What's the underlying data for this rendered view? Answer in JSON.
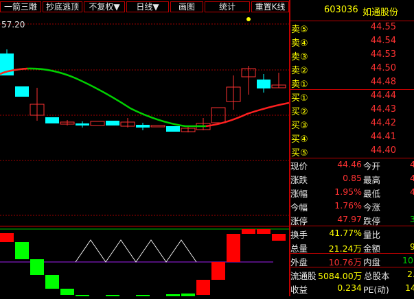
{
  "toolbar": {
    "items": [
      "一箭三雕",
      "抄底逃顶",
      "不复权▼",
      "日线▼",
      "画图",
      "统计",
      "重置K线"
    ]
  },
  "chart": {
    "price_label": "57.20",
    "colors": {
      "up": "#ff3232",
      "down": "#00ffff",
      "ma_up": "#ff2020",
      "ma_down": "#00e000",
      "grid": "#a00000",
      "indicator_line": "#a020f0"
    }
  },
  "quote": {
    "code": "603036",
    "name": "如通股份",
    "asks": [
      {
        "label": "卖⑤",
        "price": "44.55"
      },
      {
        "label": "卖④",
        "price": "44.54"
      },
      {
        "label": "卖③",
        "price": "44.53"
      },
      {
        "label": "卖②",
        "price": "44.50"
      },
      {
        "label": "卖①",
        "price": "44.48"
      }
    ],
    "bids": [
      {
        "label": "买①",
        "price": "44.44"
      },
      {
        "label": "买②",
        "price": "44.43"
      },
      {
        "label": "买③",
        "price": "44.42"
      },
      {
        "label": "买④",
        "price": "44.41"
      },
      {
        "label": "买⑤",
        "price": "44.40"
      }
    ],
    "stats": [
      {
        "l1": "现价",
        "v1": "44.46",
        "l2": "今开",
        "v2": "4"
      },
      {
        "l1": "涨跌",
        "v1": "0.85",
        "l2": "最高",
        "v2": "4"
      },
      {
        "l1": "涨幅",
        "v1": "1.95%",
        "l2": "最低",
        "v2": "4"
      },
      {
        "l1": "今幅",
        "v1": "1.76%",
        "l2": "今涨",
        "v2": ""
      },
      {
        "l1": "涨停",
        "v1": "47.97",
        "l2": "跌停",
        "v2": "3"
      },
      {
        "l1": "换手",
        "v1": "41.77%",
        "l2": "量比",
        "v2": ""
      },
      {
        "l1": "总量",
        "v1": "21.24万",
        "l2": "金额",
        "v2": "9."
      },
      {
        "l1": "外盘",
        "v1": "10.76万",
        "l2": "内盘",
        "v2": "10."
      },
      {
        "l1": "流通股",
        "v1": "5084.00万",
        "l2": "总股本",
        "v2": "2."
      },
      {
        "l1": "收益",
        "v1": "0.234",
        "l2": "PE(动)",
        "v2": "14"
      }
    ]
  }
}
